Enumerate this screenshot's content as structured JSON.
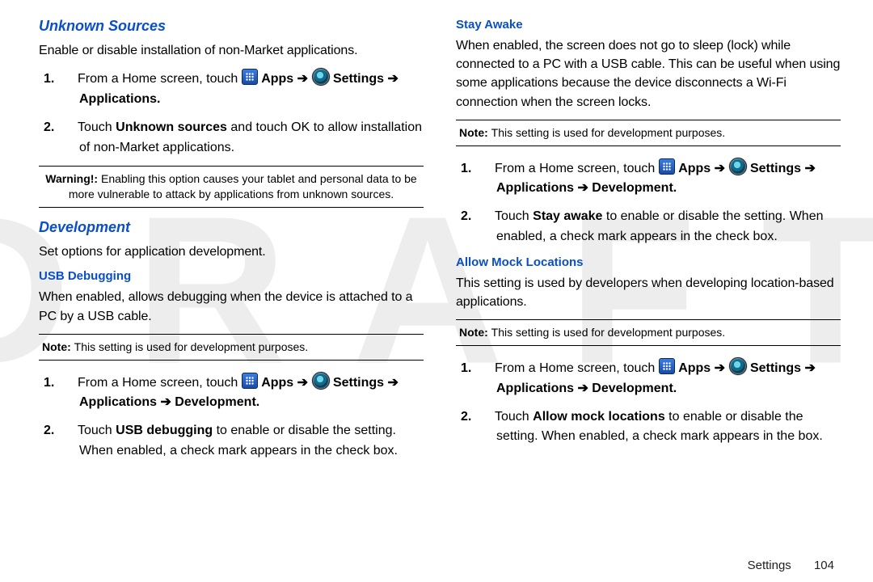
{
  "watermark": "DRAFT",
  "footer": {
    "section": "Settings",
    "page": "104"
  },
  "left": {
    "unknown_sources": {
      "title": "Unknown Sources",
      "desc": "Enable or disable installation of non-Market applications.",
      "steps": {
        "s1_a": "From a Home screen, touch ",
        "s1_apps": "Apps",
        "s1_b": " ➔ ",
        "s1_settings": "Settings",
        "s1_c": " ➔ Applications.",
        "s2_a": "Touch ",
        "s2_b": "Unknown sources",
        "s2_c": " and touch OK to allow installation of non-Market applications."
      },
      "warning_label": "Warning!: ",
      "warning_text": "Enabling this option causes your tablet and personal data to be more vulnerable to attack by applications from unknown sources."
    },
    "development": {
      "title": "Development",
      "desc": "Set options for application development."
    },
    "usb_debugging": {
      "title": "USB Debugging",
      "desc": "When enabled, allows debugging when the device is attached to a PC by a USB cable.",
      "note_label": "Note: ",
      "note_text": "This setting is used for development purposes.",
      "steps": {
        "s1_a": "From a Home screen, touch ",
        "s1_apps": "Apps",
        "s1_b": " ➔ ",
        "s1_settings": "Settings",
        "s1_c": " ➔ Applications ➔ Development.",
        "s2_a": "Touch ",
        "s2_b": "USB debugging",
        "s2_c": " to enable or disable the setting. When enabled, a check mark appears in the check box."
      }
    }
  },
  "right": {
    "stay_awake": {
      "title": "Stay Awake",
      "desc": "When enabled, the screen does not go to sleep (lock) while connected to a PC with a USB cable. This can be useful when using some applications because the device disconnects a Wi-Fi connection when the screen locks.",
      "note_label": "Note: ",
      "note_text": "This setting is used for development purposes.",
      "steps": {
        "s1_a": "From a Home screen, touch ",
        "s1_apps": "Apps",
        "s1_b": " ➔ ",
        "s1_settings": "Settings",
        "s1_c": " ➔ Applications ➔ Development.",
        "s2_a": "Touch ",
        "s2_b": "Stay awake",
        "s2_c": " to enable or disable the setting. When enabled, a check mark appears in the check box."
      }
    },
    "mock_locations": {
      "title": "Allow Mock Locations",
      "desc": "This setting is used by developers when developing location-based applications.",
      "note_label": "Note: ",
      "note_text": "This setting is used for development purposes.",
      "steps": {
        "s1_a": "From a Home screen, touch ",
        "s1_apps": "Apps",
        "s1_b": " ➔ ",
        "s1_settings": "Settings",
        "s1_c": " ➔ Applications ➔ Development.",
        "s2_a": "Touch ",
        "s2_b": "Allow mock locations",
        "s2_c": " to enable or disable the setting. When enabled, a check mark appears in the box."
      }
    }
  }
}
